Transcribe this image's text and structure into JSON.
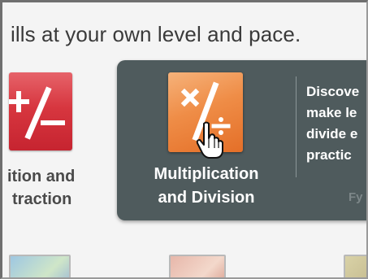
{
  "header": {
    "tagline": "ills at your own level and pace."
  },
  "cards": {
    "left": {
      "icon": "add-subtract-icon",
      "label_line1": "ition and",
      "label_line2": "traction",
      "color": "#d7363f"
    },
    "selected": {
      "icon": "multiply-divide-icon",
      "title_line1": "Multiplication",
      "title_line2": "and Division",
      "description_lines": [
        "Discove",
        "make le",
        "divide e",
        "practic"
      ],
      "faded_text": "Fy",
      "card_color": "#4f5b5d",
      "icon_color": "#ef8d47"
    }
  },
  "thumbnails": [
    "thumbnail-1",
    "thumbnail-2",
    "thumbnail-3"
  ],
  "cursor": {
    "icon": "hand-pointer-icon"
  }
}
